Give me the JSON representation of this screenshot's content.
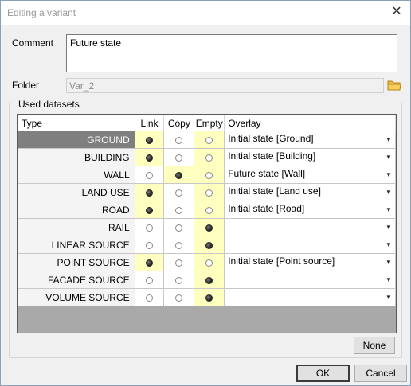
{
  "window": {
    "title": "Editing a variant",
    "close_glyph": "✕"
  },
  "comment": {
    "label": "Comment",
    "value": "Future state"
  },
  "folder": {
    "label": "Folder",
    "value": "Var_2"
  },
  "datasets": {
    "group_label": "Used datasets",
    "columns": {
      "type": "Type",
      "link": "Link",
      "copy": "Copy",
      "empty": "Empty",
      "overlay": "Overlay"
    },
    "rows": [
      {
        "type": "GROUND",
        "choice": "link",
        "overlay": "Initial state [Ground]",
        "selected": true
      },
      {
        "type": "BUILDING",
        "choice": "link",
        "overlay": "Initial state [Building]"
      },
      {
        "type": "WALL",
        "choice": "copy",
        "overlay": "Future state [Wall]"
      },
      {
        "type": "LAND USE",
        "choice": "link",
        "overlay": "Initial state [Land use]"
      },
      {
        "type": "ROAD",
        "choice": "link",
        "overlay": "Initial state [Road]"
      },
      {
        "type": "RAIL",
        "choice": "empty",
        "overlay": ""
      },
      {
        "type": "LINEAR SOURCE",
        "choice": "empty",
        "overlay": ""
      },
      {
        "type": "POINT SOURCE",
        "choice": "link",
        "overlay": "Initial state [Point source]"
      },
      {
        "type": "FACADE SOURCE",
        "choice": "empty",
        "overlay": ""
      },
      {
        "type": "VOLUME SOURCE",
        "choice": "empty",
        "overlay": ""
      }
    ]
  },
  "buttons": {
    "none": "None",
    "ok": "OK",
    "cancel": "Cancel"
  },
  "colors": {
    "accent_cell": "#ffffc0",
    "selected_row": "#7f7f7f",
    "folder_icon": "#e8b83a"
  },
  "icons": {
    "folder": "folder-icon",
    "dropdown": "chevron-down-icon",
    "close": "close-icon"
  }
}
